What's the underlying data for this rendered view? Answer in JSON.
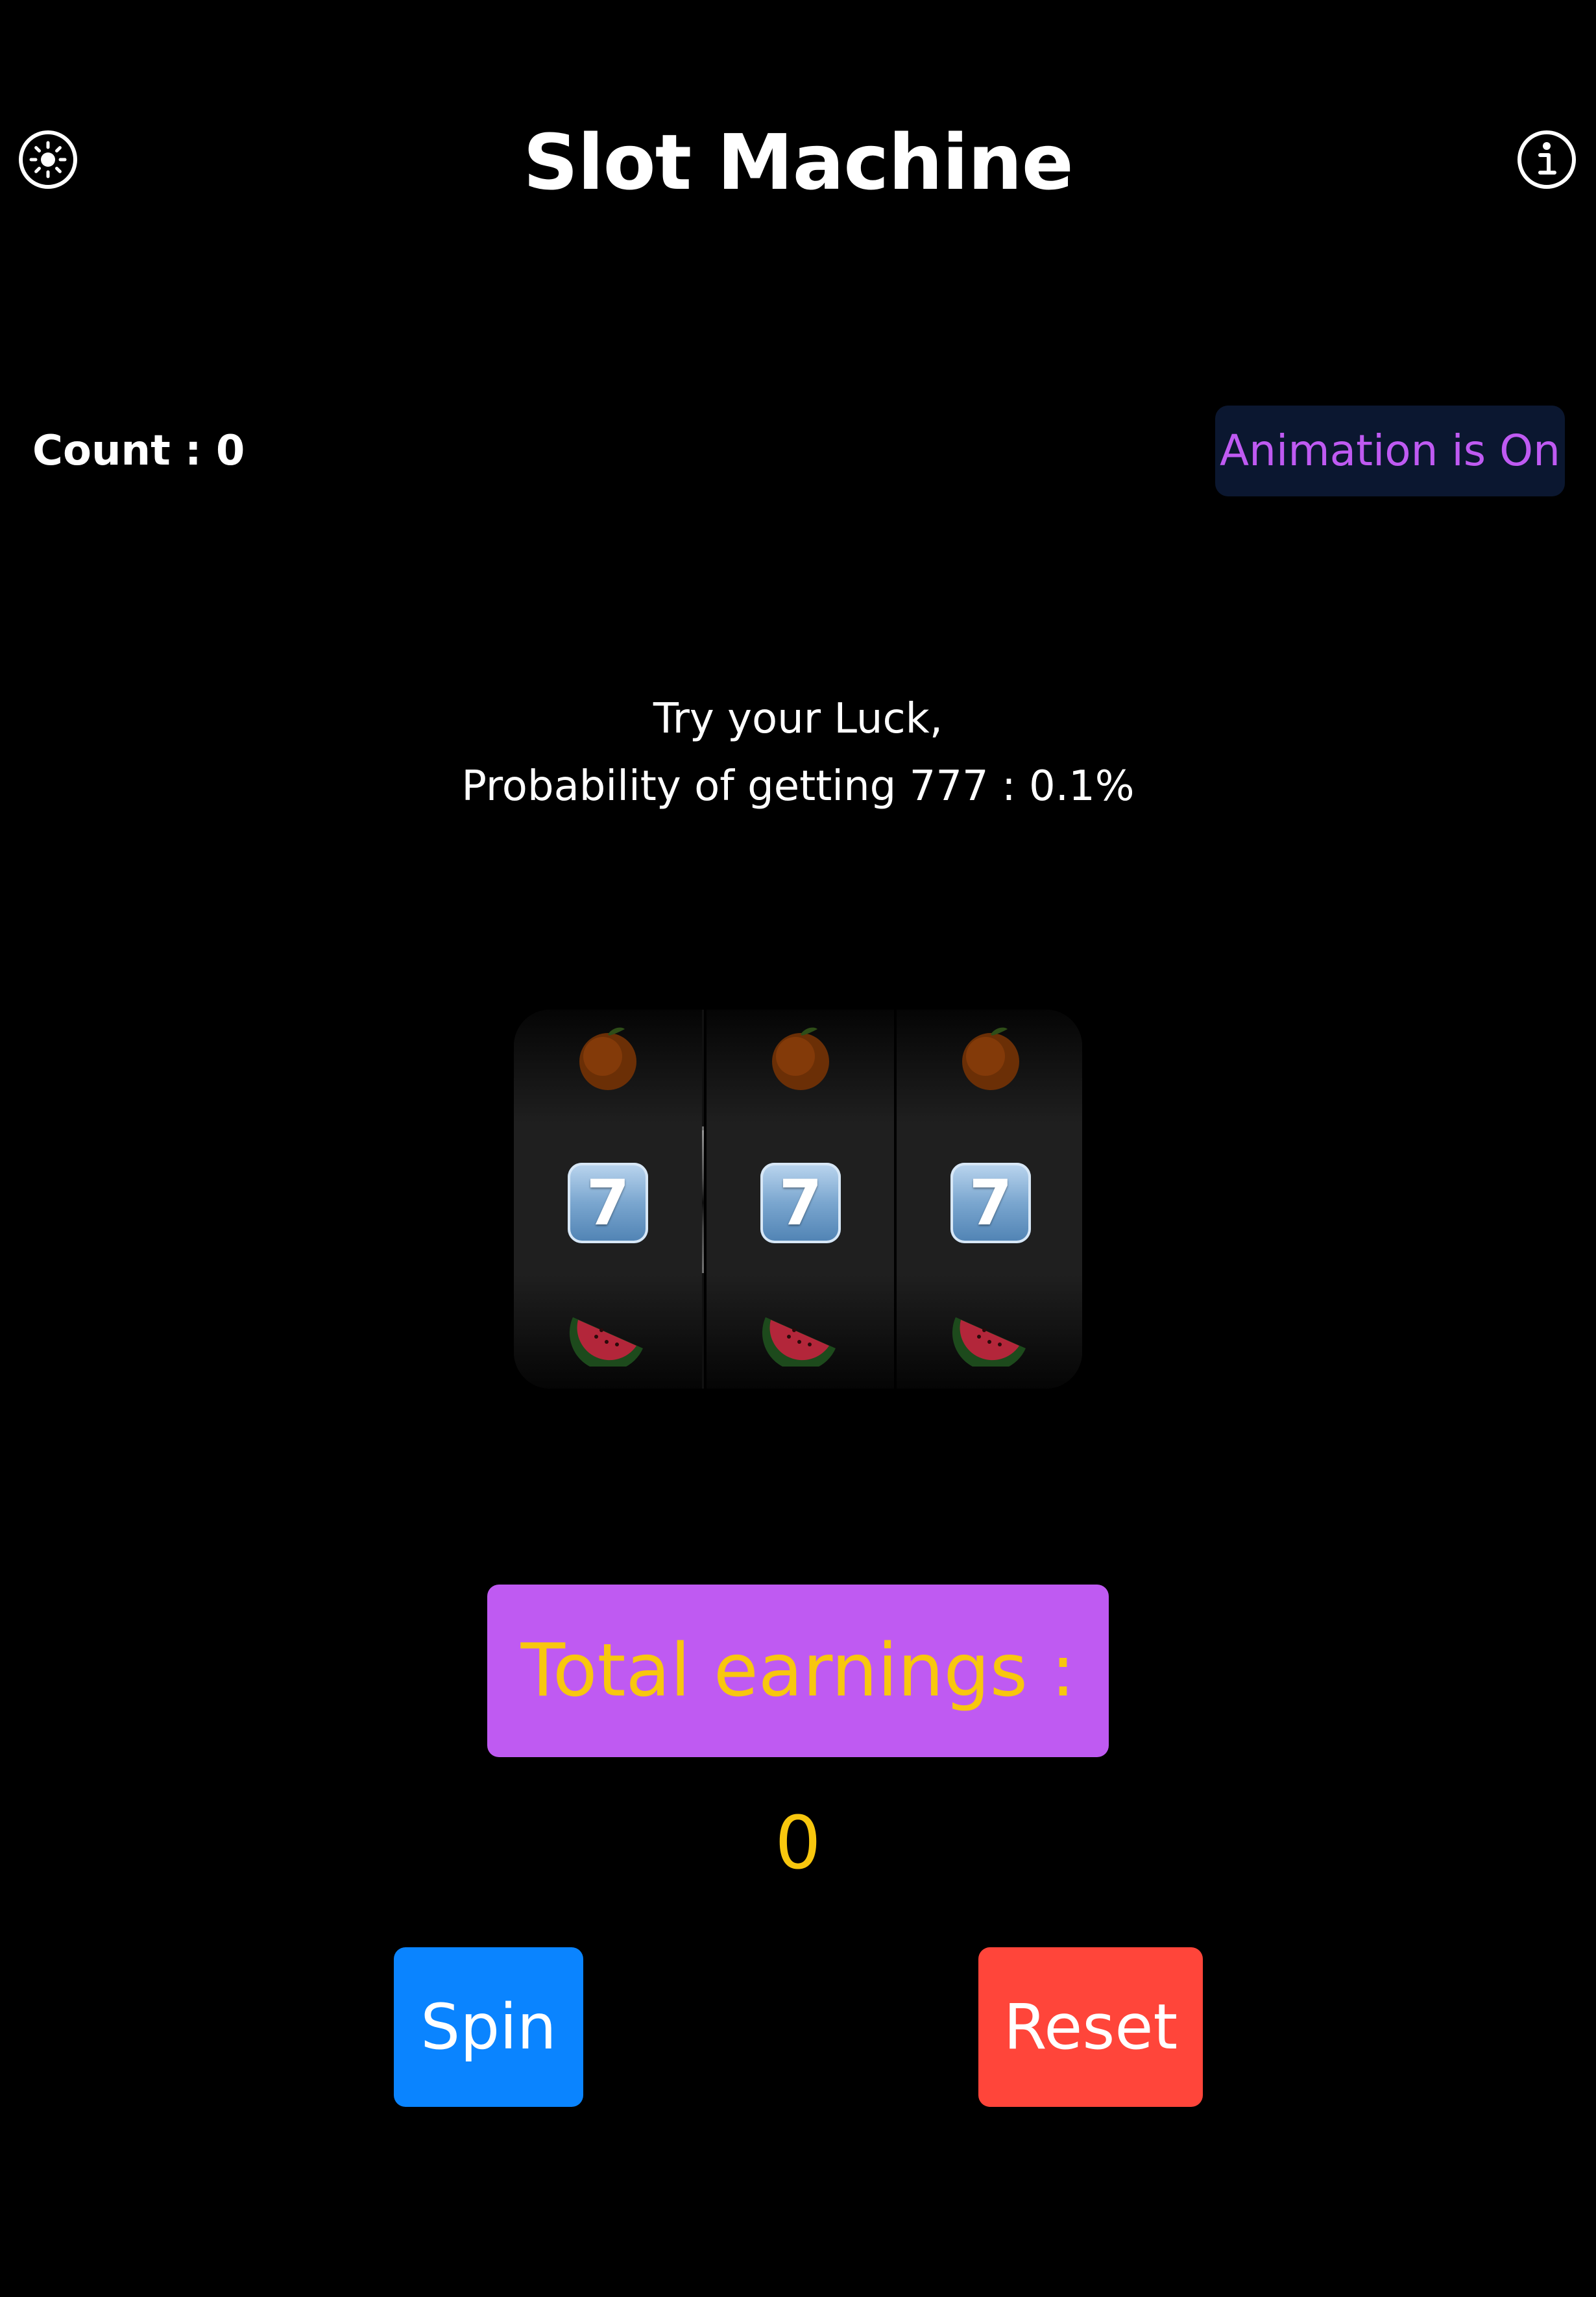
{
  "header": {
    "title": "Slot Machine",
    "left_icon": "brightness-icon",
    "right_icon": "info-icon"
  },
  "status": {
    "count_label": "Count : 0",
    "animation_toggle_label": "Animation is On"
  },
  "tagline": {
    "line1": "Try your Luck,",
    "line2": "Probability of getting 777 : 0.1%"
  },
  "reels": [
    {
      "top": "orange",
      "middle": "7",
      "bottom": "watermelon"
    },
    {
      "top": "orange",
      "middle": "7",
      "bottom": "watermelon"
    },
    {
      "top": "orange",
      "middle": "7",
      "bottom": "watermelon"
    }
  ],
  "earnings": {
    "label": "Total earnings : 0"
  },
  "actions": {
    "spin_label": "Spin",
    "reset_label": "Reset"
  },
  "colors": {
    "background": "#000000",
    "accent_purple": "#bf5af2",
    "earnings_text": "#f8c70e",
    "spin_blue": "#0a84ff",
    "reset_red": "#ff453a",
    "toggle_bg": "#0b1730"
  }
}
